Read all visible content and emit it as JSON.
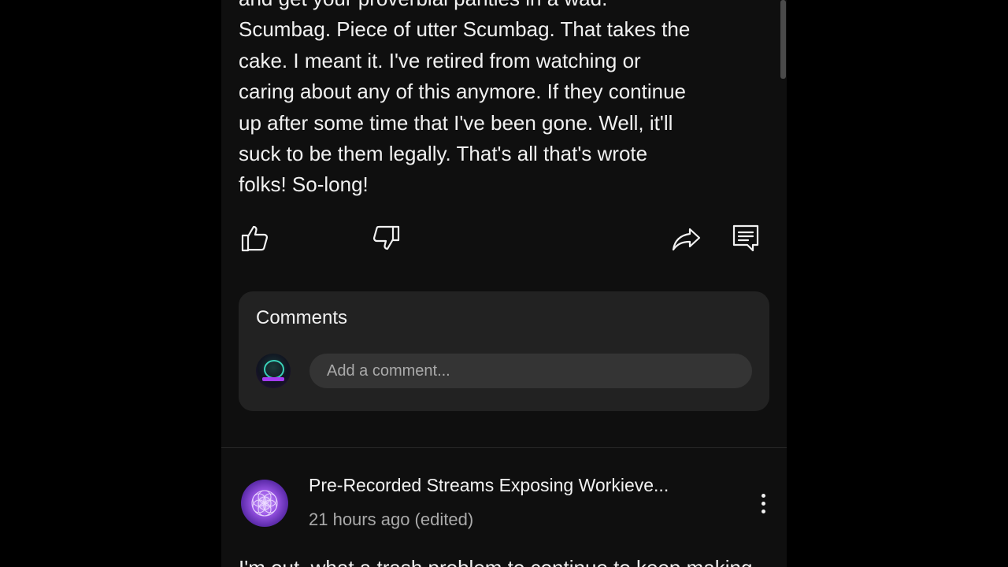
{
  "post": {
    "body_lines": [
      "and get your proverbial panties in a wad.",
      "Scumbag. Piece of utter Scumbag. That takes the",
      "cake. I meant it. I've retired from watching or",
      "caring about any of this anymore. If they continue",
      "up after some time that I've been gone. Well, it'll",
      "suck to be them legally. That's all that's wrote",
      "folks! So-long!"
    ],
    "actions": {
      "like_icon": "thumbs-up-icon",
      "dislike_icon": "thumbs-down-icon",
      "share_icon": "share-icon",
      "comments_icon": "comment-icon"
    }
  },
  "comments": {
    "title": "Comments",
    "placeholder": "Add a comment..."
  },
  "next_post": {
    "channel_name": "Pre-Recorded Streams Exposing Workieve...",
    "time": "21 hours ago (edited)",
    "preview_text": "I'm out, what a trash problem to continue to keep making"
  },
  "colors": {
    "background": "#0f0f0f",
    "card": "#222222",
    "input": "#343434",
    "text_primary": "#f1f1f1",
    "text_secondary": "#aaaaaa"
  }
}
